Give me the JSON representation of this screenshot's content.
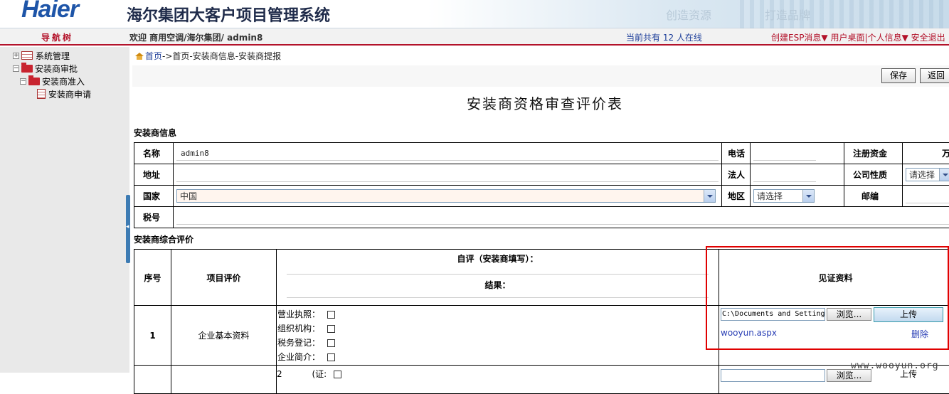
{
  "header": {
    "logo": "Haier",
    "system_title": "海尔集团大客户项目管理系统",
    "slogan_1": "创造资源",
    "slogan_2": "打造品牌"
  },
  "infobar": {
    "nav_title": "导航树",
    "welcome": "欢迎 商用空调/海尔集团/ admin8",
    "online": "当前共有  12 人在线",
    "link_esp": "创建ESP消息▼",
    "link_desktop": "用户桌面",
    "link_profile": "个人信息▼",
    "link_logout": "安全退出"
  },
  "sidebar": {
    "items": [
      {
        "label": "系统管理"
      },
      {
        "label": "安装商审批"
      },
      {
        "label": "安装商准入"
      },
      {
        "label": "安装商申请"
      }
    ]
  },
  "breadcrumb": {
    "home": "首页",
    "sep": "->",
    "path": "首页-安装商信息-安装商提报"
  },
  "toolbar": {
    "save_label": "保存",
    "back_label": "返回"
  },
  "form": {
    "title": "安装商资格审查评价表",
    "section_info": "安装商信息",
    "label_name": "名称",
    "name_value": "admin8",
    "label_phone": "电话",
    "label_capital": "注册资金",
    "capital_unit": "万元",
    "label_address": "地址",
    "label_legal": "法人",
    "label_company_type": "公司性质",
    "company_type_value": "请选择",
    "label_country": "国家",
    "country_value": "中国",
    "label_region": "地区",
    "region_value": "请选择",
    "label_zip": "邮编",
    "label_tax": "税号",
    "section_eval": "安装商综合评价",
    "col_no": "序号",
    "col_item": "项目评价",
    "col_self_eval": "自评（安装商填写）：",
    "col_result": "结果：",
    "col_evidence": "见证资料",
    "row1": {
      "no": "1",
      "item": "企业基本资料",
      "checks": [
        "营业执照：",
        "组织机构：",
        "税务登记：",
        "企业简介："
      ],
      "file_path": "C:\\Documents and Setting",
      "browse_label": "浏览...",
      "upload_label": "上传",
      "file_link": "wooyun.aspx",
      "delete_label": "删除"
    },
    "row2_partial": {
      "check_label": "2",
      "check_label_suffix": "(证:",
      "browse_label": "浏览...",
      "upload_label": "上传"
    }
  },
  "watermark": "www.wooyun.org"
}
